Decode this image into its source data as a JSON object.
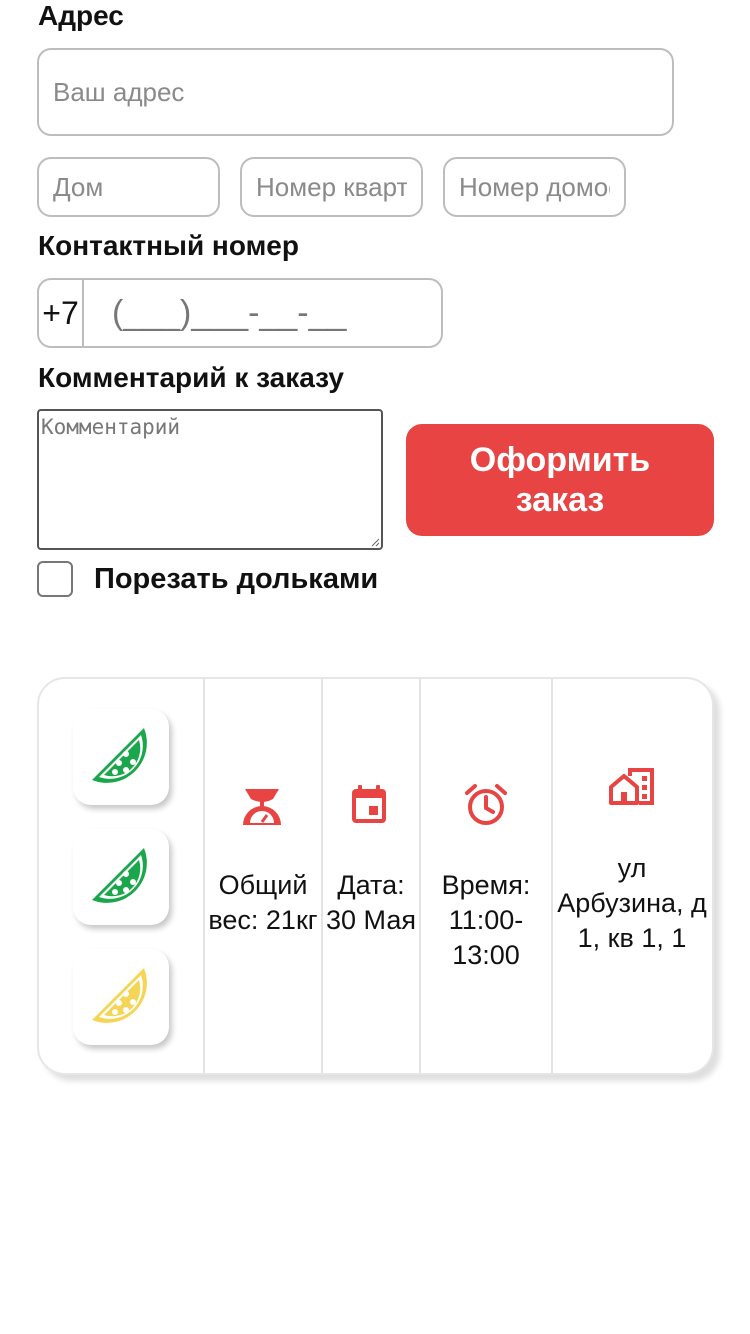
{
  "address": {
    "label": "Адрес",
    "street_placeholder": "Ваш адрес",
    "house_placeholder": "Дом",
    "flat_placeholder": "Номер квартиры",
    "intercom_placeholder": "Номер домофона"
  },
  "phone": {
    "label": "Контактный номер",
    "prefix": "+7",
    "placeholder": "(___)___-__-__"
  },
  "comment": {
    "label": "Комментарий к заказу",
    "placeholder": "Комментарий"
  },
  "order_button": {
    "label": "Оформить заказ"
  },
  "slice_option": {
    "label": "Порезать дольками",
    "checked": false
  },
  "summary": {
    "fruits": [
      {
        "icon": "watermelon-slice-icon",
        "color": "#1aa64a"
      },
      {
        "icon": "watermelon-slice-icon",
        "color": "#1aa64a"
      },
      {
        "icon": "yellow-watermelon-slice-icon",
        "color": "#f5d556"
      }
    ],
    "weight": {
      "icon": "scale-icon",
      "text": "Общий вес: 21кг"
    },
    "date": {
      "icon": "calendar-icon",
      "text": "Дата: 30 Мая"
    },
    "time": {
      "icon": "alarm-clock-icon",
      "text": "Время: 11:00-13:00"
    },
    "delivery_address": {
      "icon": "building-icon",
      "text": "ул Арбузина, д 1, кв 1, 1"
    }
  },
  "colors": {
    "accent": "#e84444",
    "green": "#1aa64a",
    "yellow": "#f5d556"
  }
}
